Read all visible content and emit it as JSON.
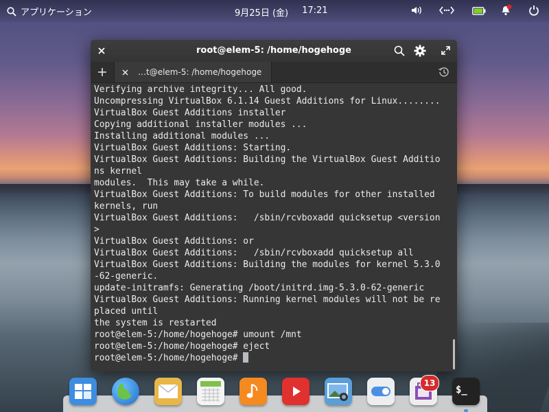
{
  "panel": {
    "applications_label": "アプリケーション",
    "date": "9月25日 (金)",
    "time": "17:21"
  },
  "window": {
    "title": "root@elem-5: /home/hogehoge",
    "tab_label": "…t@elem-5: /home/hogehoge"
  },
  "terminal": {
    "lines": [
      "Verifying archive integrity... All good.",
      "Uncompressing VirtualBox 6.1.14 Guest Additions for Linux........",
      "VirtualBox Guest Additions installer",
      "Copying additional installer modules ...",
      "Installing additional modules ...",
      "VirtualBox Guest Additions: Starting.",
      "VirtualBox Guest Additions: Building the VirtualBox Guest Additio",
      "ns kernel",
      "modules.  This may take a while.",
      "VirtualBox Guest Additions: To build modules for other installed",
      "kernels, run",
      "VirtualBox Guest Additions:   /sbin/rcvboxadd quicksetup <version",
      ">",
      "VirtualBox Guest Additions: or",
      "VirtualBox Guest Additions:   /sbin/rcvboxadd quicksetup all",
      "VirtualBox Guest Additions: Building the modules for kernel 5.3.0",
      "-62-generic.",
      "update-initramfs: Generating /boot/initrd.img-5.3.0-62-generic",
      "VirtualBox Guest Additions: Running kernel modules will not be re",
      "placed until",
      "the system is restarted",
      "root@elem-5:/home/hogehoge# umount /mnt",
      "root@elem-5:/home/hogehoge# eject"
    ],
    "prompt": "root@elem-5:/home/hogehoge# "
  },
  "dock": {
    "items": [
      "multitasking-view-icon",
      "web-browser-icon",
      "mail-icon",
      "calendar-icon",
      "music-icon",
      "videos-icon",
      "photos-icon",
      "settings-icon",
      "appcenter-icon",
      "terminal-icon"
    ],
    "appcenter_badge": "13",
    "terminal_glyph": "$_"
  },
  "colors": {
    "window_bg": "#363636",
    "text": "#ececec",
    "battery": "#7ed321",
    "notification_dot": "#e02424"
  }
}
